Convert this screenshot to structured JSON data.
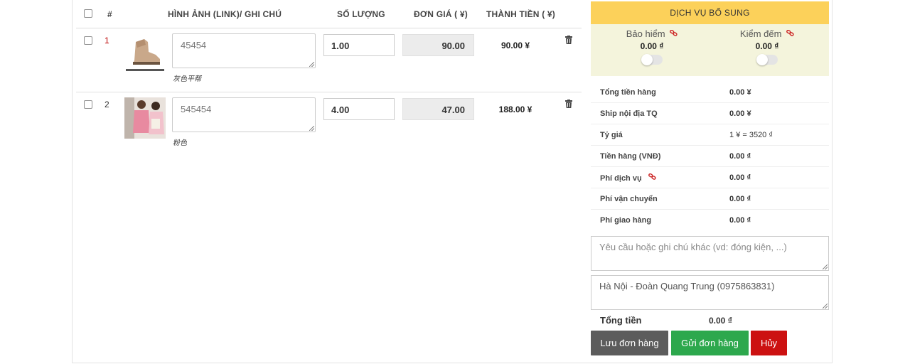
{
  "table": {
    "headers": {
      "index": "#",
      "image_note": "HÌNH ẢNH (LINK)/ GHI CHÚ",
      "quantity": "SỐ LƯỢNG",
      "unit_price": "ĐƠN GIÁ ( ¥)",
      "total": "THÀNH TIỀN ( ¥)"
    },
    "rows": [
      {
        "index": "1",
        "note": "45454",
        "property": "灰色平帮",
        "quantity": "1.00",
        "unit_price": "90.00",
        "total": "90.00 ¥"
      },
      {
        "index": "2",
        "note": "545454",
        "property": "粉色",
        "quantity": "4.00",
        "unit_price": "47.00",
        "total": "188.00 ¥"
      }
    ]
  },
  "panel": {
    "title": "DỊCH VỤ BỔ SUNG",
    "insurance": {
      "label": "Bảo hiểm",
      "value": "0.00 ₫"
    },
    "counting": {
      "label": "Kiểm đếm",
      "value": "0.00 ₫"
    },
    "summary": [
      {
        "label": "Tổng tiền hàng",
        "value": "0.00 ¥"
      },
      {
        "label": "Ship nội địa TQ",
        "value": "0.00 ¥"
      },
      {
        "label": "Tỷ giá",
        "value": "1 ¥ = 3520 ₫"
      },
      {
        "label": "Tiền hàng (VNĐ)",
        "value": "0.00 ₫"
      },
      {
        "label": "Phí dịch vụ",
        "value": "0.00 ₫"
      },
      {
        "label": "Phí vận chuyển",
        "value": "0.00 ₫"
      },
      {
        "label": "Phí giao hàng",
        "value": "0.00 ₫"
      }
    ],
    "note_placeholder": "Yêu cầu hoặc ghi chú khác (vd: đóng kiện, ...)",
    "address": "Hà Nội - Đoàn Quang Trung (0975863831)",
    "grand_total_label": "Tổng tiền",
    "grand_total_value": "0.00 ₫",
    "buttons": {
      "save": "Lưu đơn hàng",
      "send": "Gửi đơn hàng",
      "cancel": "Hủy"
    }
  },
  "colors": {
    "panel_header": "#fcd15a",
    "save": "#5c5c5c",
    "send": "#2da84d",
    "cancel": "#cc1111",
    "link_icon": "#cc2222"
  },
  "icons": {
    "delete": "trash-icon",
    "link": "link-icon"
  }
}
